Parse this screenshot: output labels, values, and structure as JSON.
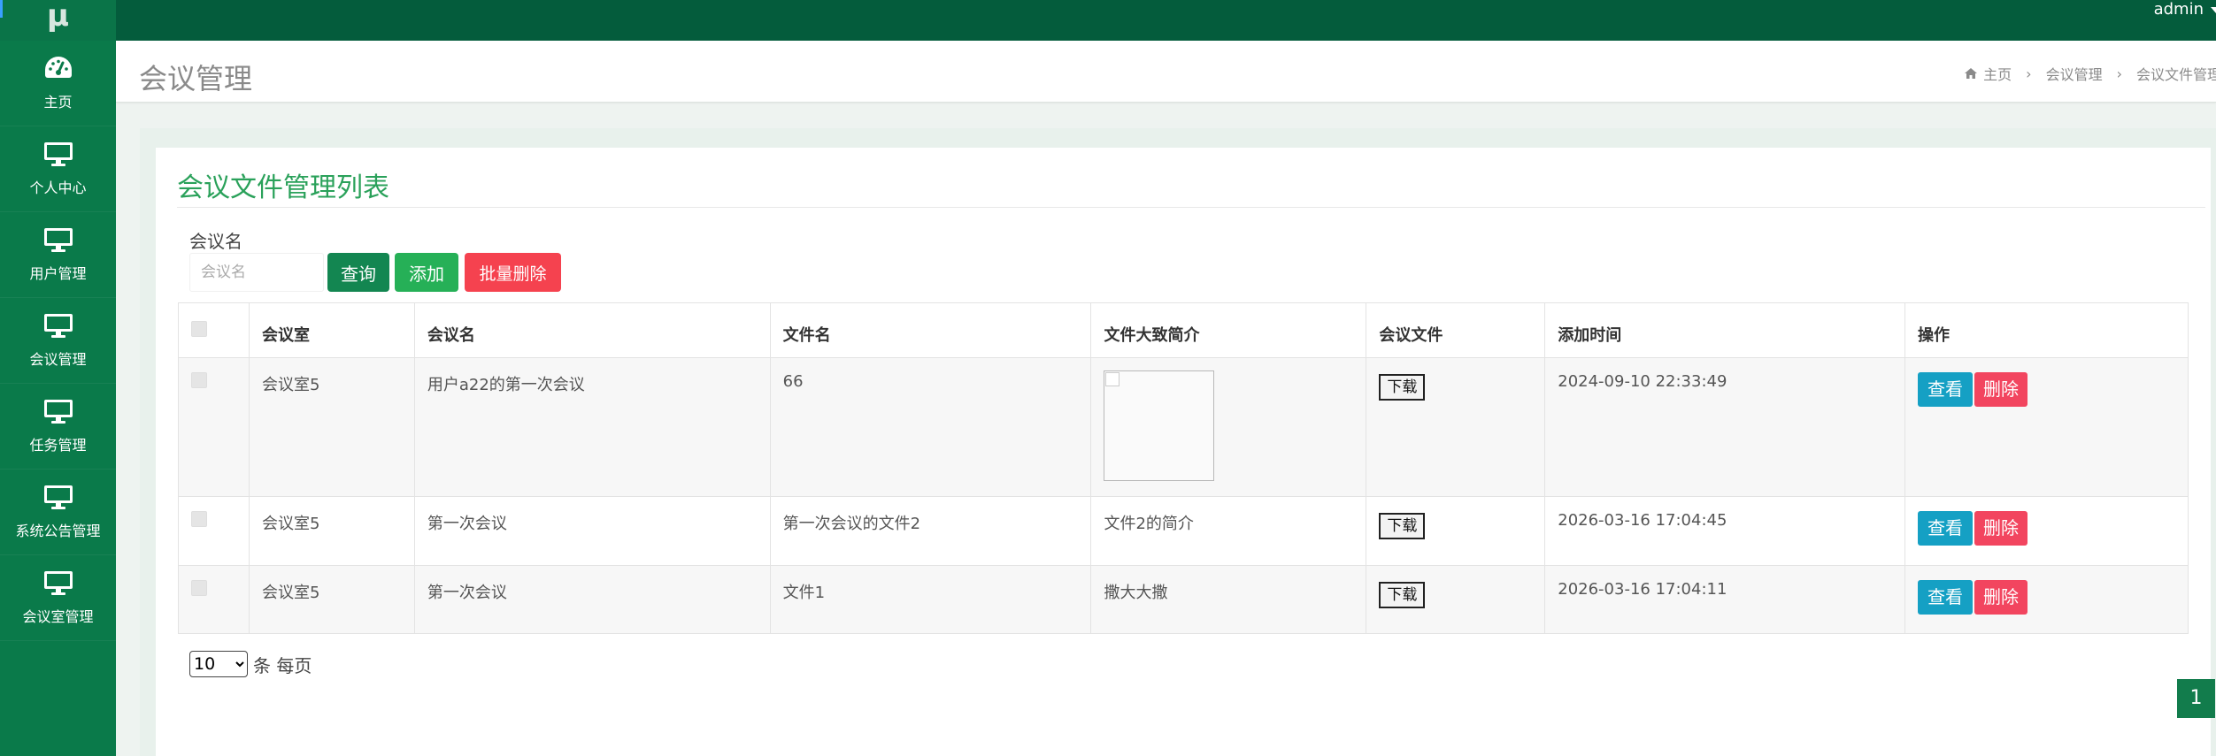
{
  "app": {
    "logo_text": "μ",
    "user": "admin"
  },
  "sidebar": {
    "items": [
      {
        "label": "主页",
        "icon": "dashboard-icon"
      },
      {
        "label": "个人中心",
        "icon": "monitor-icon"
      },
      {
        "label": "用户管理",
        "icon": "monitor-icon"
      },
      {
        "label": "会议管理",
        "icon": "monitor-icon"
      },
      {
        "label": "任务管理",
        "icon": "monitor-icon"
      },
      {
        "label": "系统公告管理",
        "icon": "monitor-icon"
      },
      {
        "label": "会议室管理",
        "icon": "monitor-icon"
      }
    ]
  },
  "header": {
    "title": "会议管理",
    "breadcrumb": [
      "主页",
      "会议管理",
      "会议文件管理"
    ]
  },
  "panel": {
    "title": "会议文件管理列表"
  },
  "search": {
    "label": "会议名",
    "placeholder": "会议名",
    "query_label": "查询",
    "add_label": "添加",
    "batch_delete_label": "批量删除"
  },
  "table": {
    "columns": [
      "会议室",
      "会议名",
      "文件名",
      "文件大致简介",
      "会议文件",
      "添加时间",
      "操作"
    ],
    "rows": [
      {
        "room": "会议室5",
        "meeting": "用户a22的第一次会议",
        "file": "66",
        "intro": "",
        "intro_is_image": true,
        "download": "下载",
        "time": "2024-09-10 22:33:49",
        "view": "查看",
        "delete": "删除"
      },
      {
        "room": "会议室5",
        "meeting": "第一次会议",
        "file": "第一次会议的文件2",
        "intro": "文件2的简介",
        "intro_is_image": false,
        "download": "下载",
        "time": "2026-03-16 17:04:45",
        "view": "查看",
        "delete": "删除"
      },
      {
        "room": "会议室5",
        "meeting": "第一次会议",
        "file": "文件1",
        "intro": "撒大大撒",
        "intro_is_image": false,
        "download": "下载",
        "time": "2026-03-16 17:04:11",
        "view": "查看",
        "delete": "删除"
      }
    ]
  },
  "pagination": {
    "page_size": "10",
    "page_size_suffix": "条 每页",
    "current_page": "1"
  },
  "colors": {
    "topbar": "#045c3c",
    "sidebar": "#0a7a4a",
    "accent": "#2aa15a",
    "danger": "#f2455f",
    "info": "#15a0c4"
  }
}
